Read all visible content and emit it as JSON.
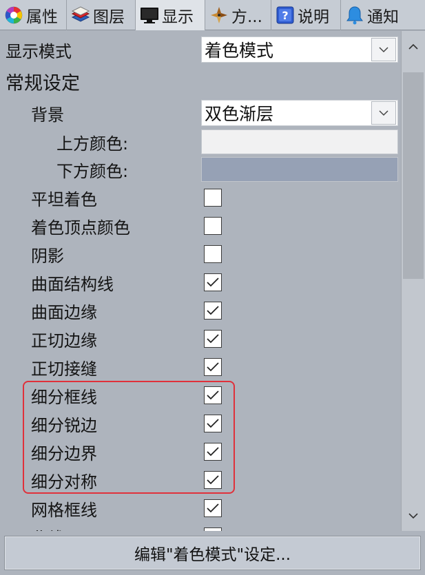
{
  "tabs": [
    {
      "label": "属性",
      "icon": "color-wheel-icon"
    },
    {
      "label": "图层",
      "icon": "layers-icon"
    },
    {
      "label": "显示",
      "icon": "monitor-icon"
    },
    {
      "label": "方...",
      "icon": "compass-icon"
    },
    {
      "label": "说明",
      "icon": "help-icon"
    },
    {
      "label": "通知",
      "icon": "bell-icon"
    }
  ],
  "display_mode": {
    "label": "显示模式",
    "value": "着色模式"
  },
  "general_section": "常规设定",
  "background": {
    "label": "背景",
    "value": "双色渐层",
    "top_color_label": "上方颜色:",
    "top_color": "#f1f1f2",
    "bottom_color_label": "下方颜色:",
    "bottom_color": "#96a1b5"
  },
  "options": [
    {
      "label": "平坦着色",
      "checked": false
    },
    {
      "label": "着色顶点颜色",
      "checked": false
    },
    {
      "label": "阴影",
      "checked": false
    },
    {
      "label": "曲面结构线",
      "checked": true
    },
    {
      "label": "曲面边缘",
      "checked": true
    },
    {
      "label": "正切边缘",
      "checked": true
    },
    {
      "label": "正切接缝",
      "checked": true
    },
    {
      "label": "细分框线",
      "checked": true
    },
    {
      "label": "细分锐边",
      "checked": true
    },
    {
      "label": "细分边界",
      "checked": true
    },
    {
      "label": "细分对称",
      "checked": true
    },
    {
      "label": "网格框线",
      "checked": true
    },
    {
      "label": "曲线",
      "checked": true
    }
  ],
  "edit_button": "编辑\"着色模式\"设定..."
}
